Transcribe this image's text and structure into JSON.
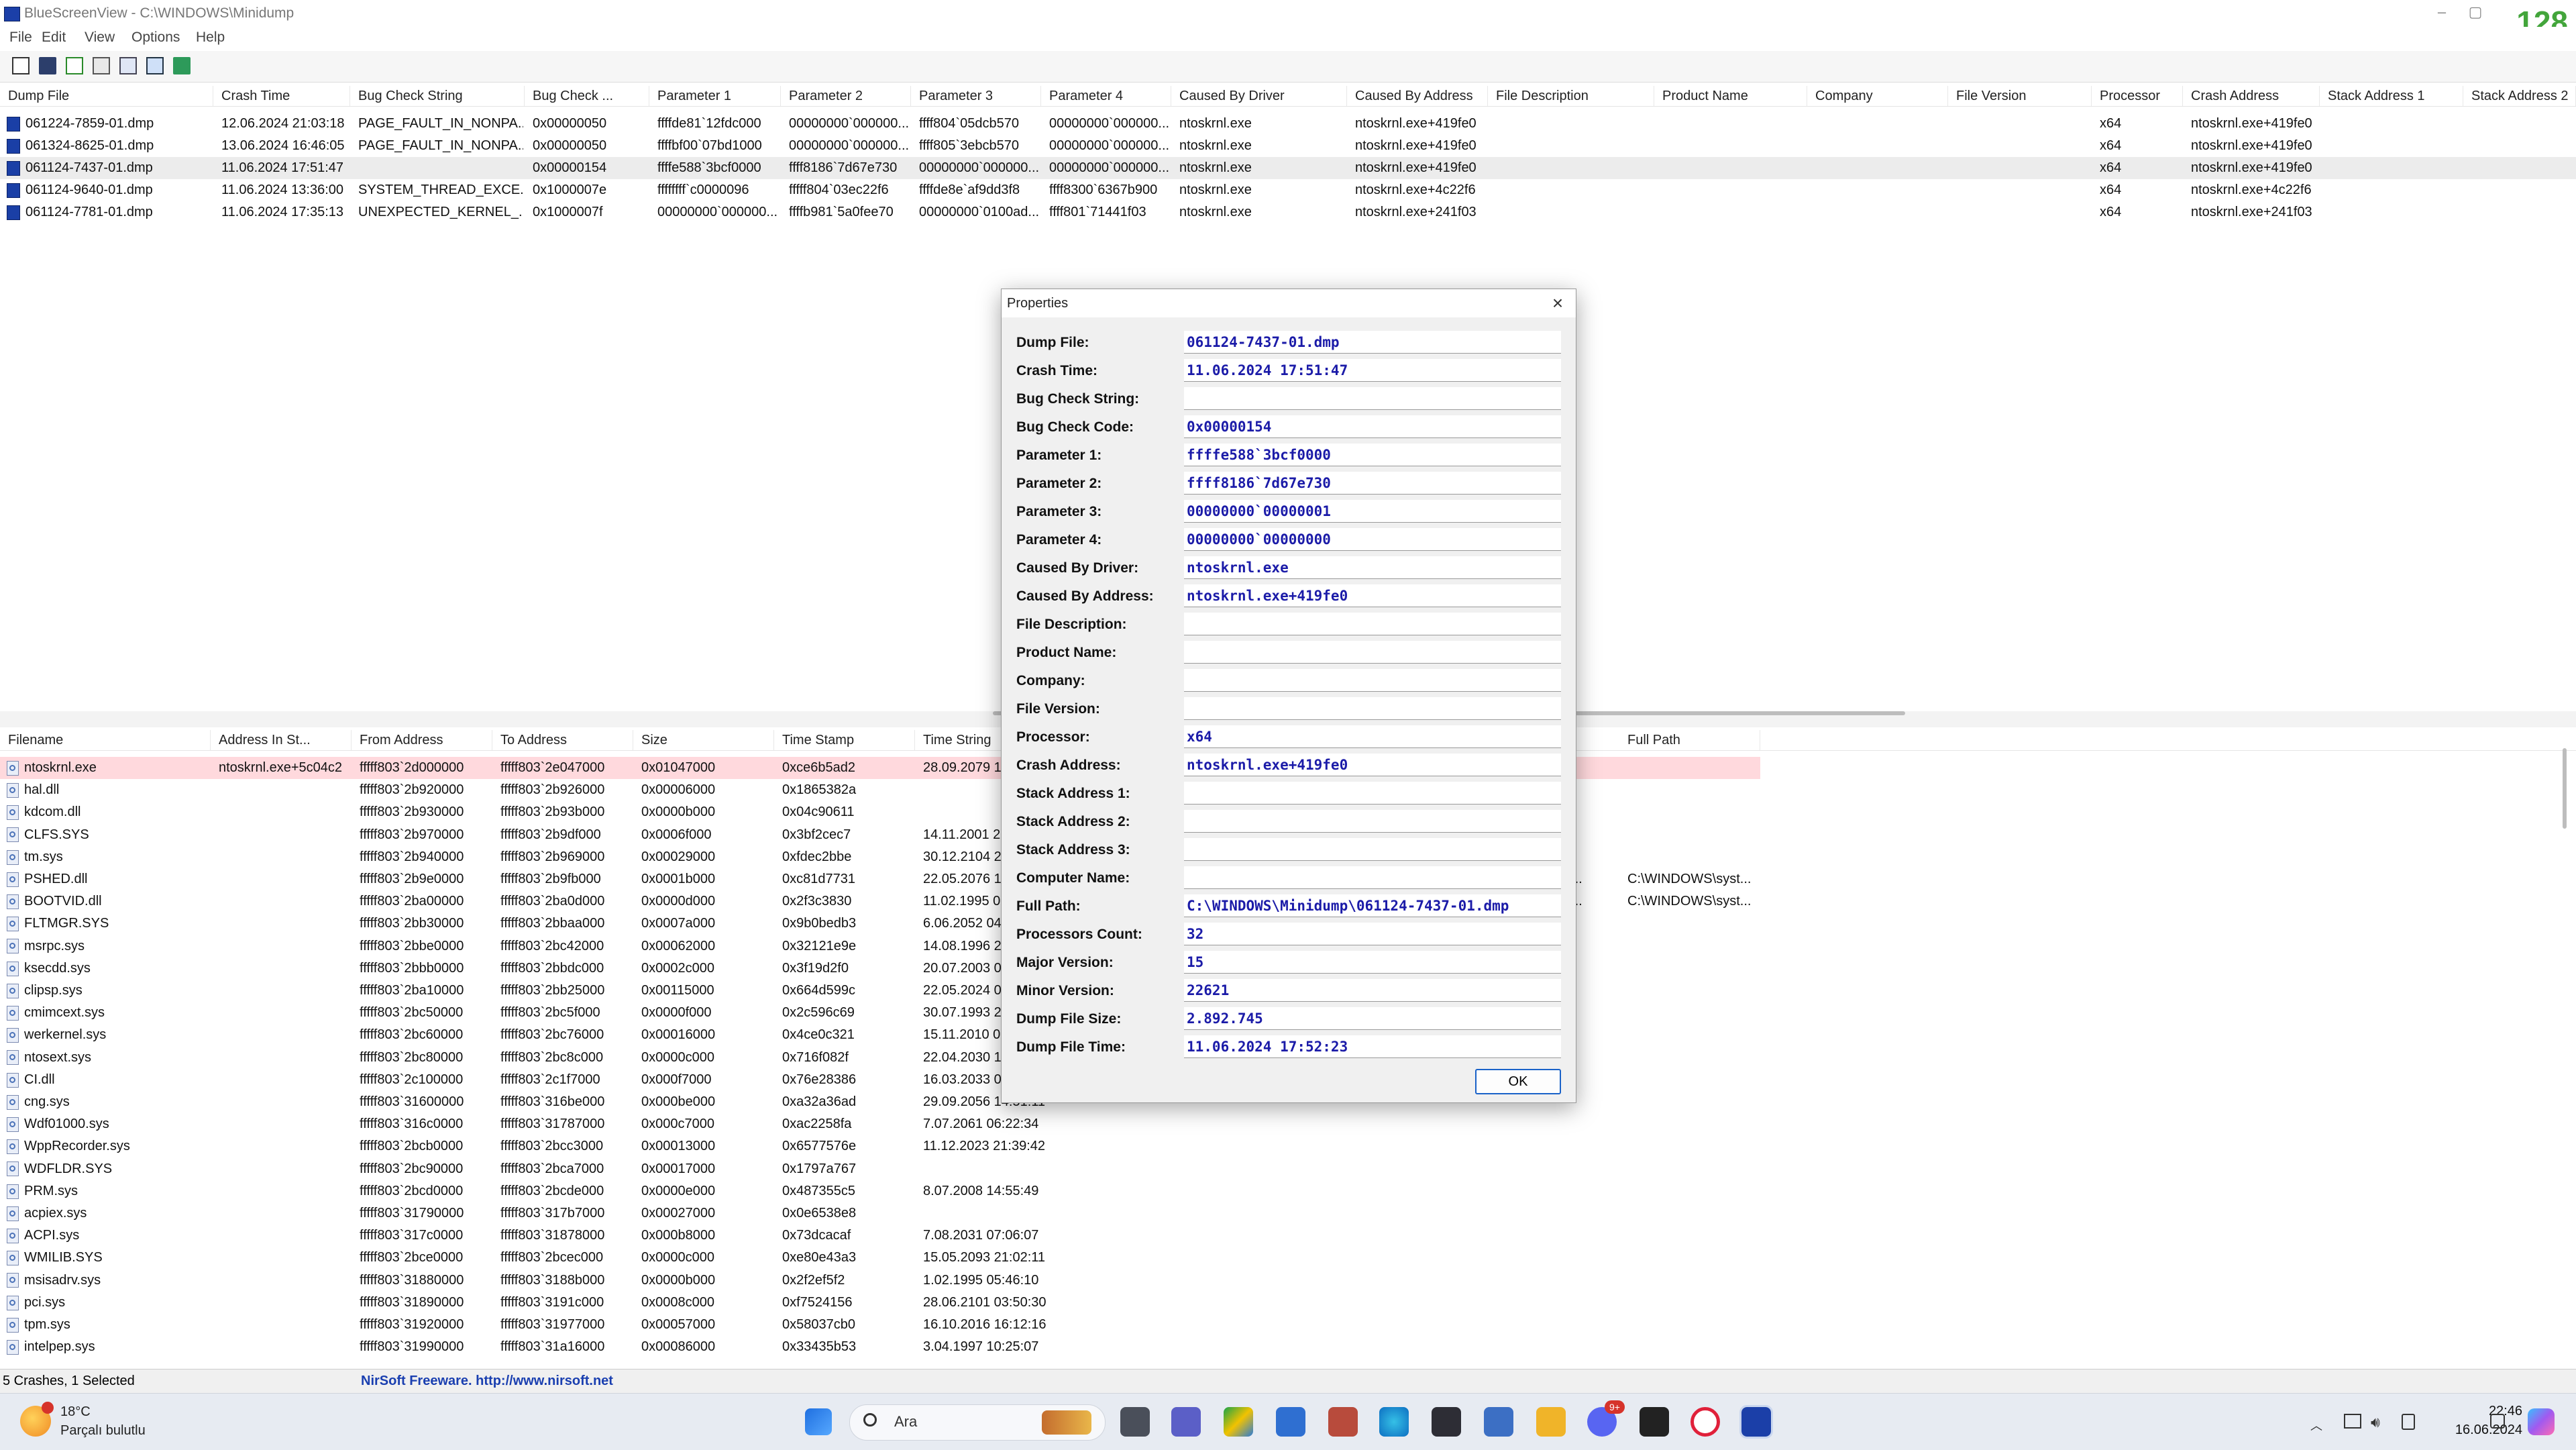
{
  "window": {
    "title": "BlueScreenView  -  C:\\WINDOWS\\Minidump",
    "badge_number": "128"
  },
  "menu": [
    "File",
    "Edit",
    "View",
    "Options",
    "Help"
  ],
  "top_columns": [
    "Dump File",
    "Crash Time",
    "Bug Check String",
    "Bug Check ...",
    "Parameter 1",
    "Parameter 2",
    "Parameter 3",
    "Parameter 4",
    "Caused By Driver",
    "Caused By Address",
    "File Description",
    "Product Name",
    "Company",
    "File Version",
    "Processor",
    "Crash Address",
    "Stack Address 1",
    "Stack Address 2"
  ],
  "dumps": [
    [
      "061224-7859-01.dmp",
      "12.06.2024 21:03:18",
      "PAGE_FAULT_IN_NONPA...",
      "0x00000050",
      "ffffde81`12fdc000",
      "00000000`000000...",
      "ffff804`05dcb570",
      "00000000`000000...",
      "ntoskrnl.exe",
      "ntoskrnl.exe+419fe0",
      "",
      "",
      "",
      "",
      "x64",
      "ntoskrnl.exe+419fe0",
      "",
      ""
    ],
    [
      "061324-8625-01.dmp",
      "13.06.2024 16:46:05",
      "PAGE_FAULT_IN_NONPA...",
      "0x00000050",
      "ffffbf00`07bd1000",
      "00000000`000000...",
      "ffff805`3ebcb570",
      "00000000`000000...",
      "ntoskrnl.exe",
      "ntoskrnl.exe+419fe0",
      "",
      "",
      "",
      "",
      "x64",
      "ntoskrnl.exe+419fe0",
      "",
      ""
    ],
    [
      "061124-7437-01.dmp",
      "11.06.2024 17:51:47",
      "",
      "0x00000154",
      "ffffe588`3bcf0000",
      "ffff8186`7d67e730",
      "00000000`000000...",
      "00000000`000000...",
      "ntoskrnl.exe",
      "ntoskrnl.exe+419fe0",
      "",
      "",
      "",
      "",
      "x64",
      "ntoskrnl.exe+419fe0",
      "",
      ""
    ],
    [
      "061124-9640-01.dmp",
      "11.06.2024 13:36:00",
      "SYSTEM_THREAD_EXCE...",
      "0x1000007e",
      "ffffffff`c0000096",
      "fffff804`03ec22f6",
      "ffffde8e`af9dd3f8",
      "ffff8300`6367b900",
      "ntoskrnl.exe",
      "ntoskrnl.exe+4c22f6",
      "",
      "",
      "",
      "",
      "x64",
      "ntoskrnl.exe+4c22f6",
      "",
      ""
    ],
    [
      "061124-7781-01.dmp",
      "11.06.2024 17:35:13",
      "UNEXPECTED_KERNEL_...",
      "0x1000007f",
      "00000000`000000...",
      "ffffb981`5a0fee70",
      "00000000`0100ad...",
      "ffff801`71441f03",
      "ntoskrnl.exe",
      "ntoskrnl.exe+241f03",
      "",
      "",
      "",
      "",
      "x64",
      "ntoskrnl.exe+241f03",
      "",
      ""
    ]
  ],
  "bottom_columns": [
    "Filename",
    "Address In St...",
    "From Address",
    "To Address",
    "Size",
    "Time Stamp",
    "Time String",
    "Full Path"
  ],
  "drivers": [
    [
      "ntoskrnl.exe",
      "ntoskrnl.exe+5c04c2",
      "fffff803`2d000000",
      "fffff803`2e047000",
      "0x01047000",
      "0xce6b5ad2",
      "28.09.2079 18",
      "",
      ""
    ],
    [
      "hal.dll",
      "",
      "fffff803`2b920000",
      "fffff803`2b926000",
      "0x00006000",
      "0x1865382a",
      "",
      "",
      ""
    ],
    [
      "kdcom.dll",
      "",
      "fffff803`2b930000",
      "fffff803`2b93b000",
      "0x0000b000",
      "0x04c90611",
      "",
      "",
      ""
    ],
    [
      "CLFS.SYS",
      "",
      "fffff803`2b970000",
      "fffff803`2b9df000",
      "0x0006f000",
      "0x3bf2cec7",
      "14.11.2001 23",
      "",
      ""
    ],
    [
      "tm.sys",
      "",
      "fffff803`2b940000",
      "fffff803`2b969000",
      "0x00029000",
      "0xfdec2bbe",
      "30.12.2104 23",
      "",
      ""
    ],
    [
      "PSHED.dll",
      "",
      "fffff803`2b9e0000",
      "fffff803`2b9fb000",
      "0x0001b000",
      "0xc81d7731",
      "22.05.2076 16",
      "pora...",
      "C:\\WINDOWS\\syst..."
    ],
    [
      "BOOTVID.dll",
      "",
      "fffff803`2ba00000",
      "fffff803`2ba0d000",
      "0x0000d000",
      "0x2f3c3830",
      "11.02.1995 07",
      "pora...",
      "C:\\WINDOWS\\syst..."
    ],
    [
      "FLTMGR.SYS",
      "",
      "fffff803`2bb30000",
      "fffff803`2bbaa000",
      "0x0007a000",
      "0x9b0bedb3",
      "6.06.2052 04",
      "",
      ""
    ],
    [
      "msrpc.sys",
      "",
      "fffff803`2bbe0000",
      "fffff803`2bc42000",
      "0x00062000",
      "0x32121e9e",
      "14.08.1996 21",
      "",
      ""
    ],
    [
      "ksecdd.sys",
      "",
      "fffff803`2bbb0000",
      "fffff803`2bbdc000",
      "0x0002c000",
      "0x3f19d2f0",
      "20.07.2003 02",
      "",
      ""
    ],
    [
      "clipsp.sys",
      "",
      "fffff803`2ba10000",
      "fffff803`2bb25000",
      "0x00115000",
      "0x664d599c",
      "22.05.2024 05",
      "",
      ""
    ],
    [
      "cmimcext.sys",
      "",
      "fffff803`2bc50000",
      "fffff803`2bc5f000",
      "0x0000f000",
      "0x2c596c69",
      "30.07.1993 21",
      "",
      ""
    ],
    [
      "werkernel.sys",
      "",
      "fffff803`2bc60000",
      "fffff803`2bc76000",
      "0x00016000",
      "0x4ce0c321",
      "15.11.2010 08",
      "",
      ""
    ],
    [
      "ntosext.sys",
      "",
      "fffff803`2bc80000",
      "fffff803`2bc8c000",
      "0x0000c000",
      "0x716f082f",
      "22.04.2030 18",
      "",
      ""
    ],
    [
      "CI.dll",
      "",
      "fffff803`2c100000",
      "fffff803`2c1f7000",
      "0x000f7000",
      "0x76e28386",
      "16.03.2033 06",
      "",
      ""
    ],
    [
      "cng.sys",
      "",
      "fffff803`31600000",
      "fffff803`316be000",
      "0x000be000",
      "0xa32a36ad",
      "29.09.2056 14:51:11",
      "",
      ""
    ],
    [
      "Wdf01000.sys",
      "",
      "fffff803`316c0000",
      "fffff803`31787000",
      "0x000c7000",
      "0xac2258fa",
      "7.07.2061 06:22:34",
      "",
      ""
    ],
    [
      "WppRecorder.sys",
      "",
      "fffff803`2bcb0000",
      "fffff803`2bcc3000",
      "0x00013000",
      "0x6577576e",
      "11.12.2023 21:39:42",
      "",
      ""
    ],
    [
      "WDFLDR.SYS",
      "",
      "fffff803`2bc90000",
      "fffff803`2bca7000",
      "0x00017000",
      "0x1797a767",
      "",
      "",
      ""
    ],
    [
      "PRM.sys",
      "",
      "fffff803`2bcd0000",
      "fffff803`2bcde000",
      "0x0000e000",
      "0x487355c5",
      "8.07.2008 14:55:49",
      "",
      ""
    ],
    [
      "acpiex.sys",
      "",
      "fffff803`31790000",
      "fffff803`317b7000",
      "0x00027000",
      "0x0e6538e8",
      "",
      "",
      ""
    ],
    [
      "ACPI.sys",
      "",
      "fffff803`317c0000",
      "fffff803`31878000",
      "0x000b8000",
      "0x73dcacaf",
      "7.08.2031 07:06:07",
      "",
      ""
    ],
    [
      "WMILIB.SYS",
      "",
      "fffff803`2bce0000",
      "fffff803`2bcec000",
      "0x0000c000",
      "0xe80e43a3",
      "15.05.2093 21:02:11",
      "",
      ""
    ],
    [
      "msisadrv.sys",
      "",
      "fffff803`31880000",
      "fffff803`3188b000",
      "0x0000b000",
      "0x2f2ef5f2",
      "1.02.1995 05:46:10",
      "",
      ""
    ],
    [
      "pci.sys",
      "",
      "fffff803`31890000",
      "fffff803`3191c000",
      "0x0008c000",
      "0xf7524156",
      "28.06.2101 03:50:30",
      "",
      ""
    ],
    [
      "tpm.sys",
      "",
      "fffff803`31920000",
      "fffff803`31977000",
      "0x00057000",
      "0x58037cb0",
      "16.10.2016 16:12:16",
      "",
      ""
    ],
    [
      "intelpep.sys",
      "",
      "fffff803`31990000",
      "fffff803`31a16000",
      "0x00086000",
      "0x33435b53",
      "3.04.1997 10:25:07",
      "",
      ""
    ]
  ],
  "dialog": {
    "title": "Properties",
    "ok_label": "OK",
    "props": [
      {
        "label": "Dump File:",
        "value": "061124-7437-01.dmp"
      },
      {
        "label": "Crash Time:",
        "value": "11.06.2024 17:51:47"
      },
      {
        "label": "Bug Check String:",
        "value": ""
      },
      {
        "label": "Bug Check Code:",
        "value": "0x00000154"
      },
      {
        "label": "Parameter 1:",
        "value": "ffffe588`3bcf0000"
      },
      {
        "label": "Parameter 2:",
        "value": "ffff8186`7d67e730"
      },
      {
        "label": "Parameter 3:",
        "value": "00000000`00000001"
      },
      {
        "label": "Parameter 4:",
        "value": "00000000`00000000"
      },
      {
        "label": "Caused By Driver:",
        "value": "ntoskrnl.exe"
      },
      {
        "label": "Caused By Address:",
        "value": "ntoskrnl.exe+419fe0"
      },
      {
        "label": "File Description:",
        "value": ""
      },
      {
        "label": "Product Name:",
        "value": ""
      },
      {
        "label": "Company:",
        "value": ""
      },
      {
        "label": "File Version:",
        "value": ""
      },
      {
        "label": "Processor:",
        "value": "x64"
      },
      {
        "label": "Crash Address:",
        "value": "ntoskrnl.exe+419fe0"
      },
      {
        "label": "Stack Address 1:",
        "value": ""
      },
      {
        "label": "Stack Address 2:",
        "value": ""
      },
      {
        "label": "Stack Address 3:",
        "value": ""
      },
      {
        "label": "Computer Name:",
        "value": ""
      },
      {
        "label": "Full Path:",
        "value": "C:\\WINDOWS\\Minidump\\061124-7437-01.dmp"
      },
      {
        "label": "Processors Count:",
        "value": "32"
      },
      {
        "label": "Major Version:",
        "value": "15"
      },
      {
        "label": "Minor Version:",
        "value": "22621"
      },
      {
        "label": "Dump File Size:",
        "value": "2.892.745"
      },
      {
        "label": "Dump File Time:",
        "value": "11.06.2024 17:52:23"
      }
    ]
  },
  "status": {
    "left": "5 Crashes, 1 Selected",
    "right": "NirSoft Freeware.  http://www.nirsoft.net"
  },
  "taskbar": {
    "temp": "18°C",
    "weather": "Parçalı bulutlu",
    "search_placeholder": "Ara",
    "time": "22:46",
    "date": "16.06.2024",
    "notif_badge": "9+"
  },
  "colors": {
    "accent": "#1a62c8",
    "value_text": "#1b1ba8",
    "highlight_row": "#ffd9dd",
    "selected_row": "#ececec",
    "badge": "#43a53b"
  }
}
